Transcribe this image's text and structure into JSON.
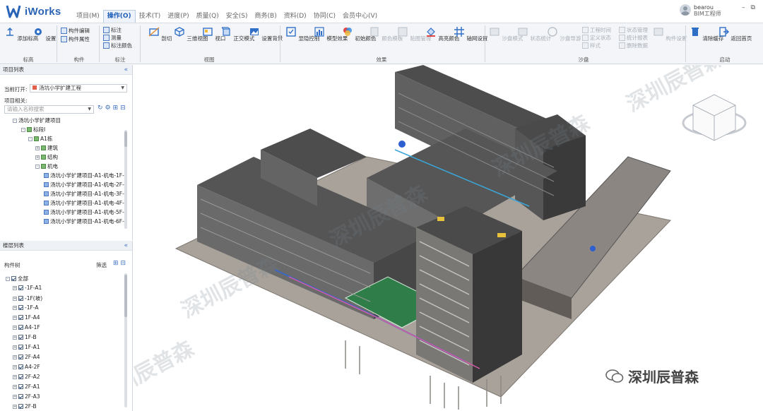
{
  "app": {
    "name": "iWorks"
  },
  "menu": [
    "项目(M)",
    "操作(O)",
    "技术(T)",
    "进度(P)",
    "质量(Q)",
    "安全(S)",
    "商务(B)",
    "资料(D)",
    "协同(C)",
    "会员中心(V)"
  ],
  "user": {
    "name": "bearou",
    "role": "BIM工程师"
  },
  "window_controls": {
    "minimize": "–",
    "restore": "⧉"
  },
  "ribbon": {
    "tools": {
      "add_mark": "添加标高",
      "settings": "设置",
      "comp_edit": "构件编辑",
      "comp_prop": "构件属性",
      "annotate": "标注",
      "measure": "测量",
      "mark_color": "标注颜色",
      "section": "剖切",
      "view3d": "三维视图",
      "viewport": "视口",
      "ortho": "正交模式",
      "bg": "设置背景",
      "visibility": "显隐控制",
      "model_effect": "模型效果",
      "init_color": "初始颜色",
      "color_tpl": "颜色模板",
      "tex_mgr": "贴图管理",
      "hl_color": "高亮颜色",
      "axis_set": "轴网设置",
      "sand_mode": "沙盘模式",
      "state_stat": "状态统计",
      "sand_roam": "沙盘导游",
      "eng_time": "工程时间",
      "def_state": "定义状态",
      "style": "样式",
      "state_mgr": "状态管理",
      "stat_report": "统计报表",
      "del_data": "删除数据",
      "comp_set": "构件设置",
      "clear_cache": "清除缓存",
      "return_home": "返回首页"
    },
    "groups": {
      "mark": "标高",
      "comp": "构件",
      "annotate": "标注",
      "view": "视图",
      "effect": "效果",
      "sand": "沙盘",
      "start": "启动"
    }
  },
  "project_panel": {
    "title": "项目列表",
    "current_label": "当前打开:",
    "current_value": "汤坑小学扩建工程",
    "related_label": "项目相关:",
    "search_placeholder": "请输入名称搜索",
    "tree": [
      "汤坑小学扩建项目",
      "标段I",
      "A1栋",
      "建筑",
      "结构",
      "机电",
      "汤坑小学扩建项目-A1-机电-1F-2",
      "汤坑小学扩建项目-A1-机电-2F-2",
      "汤坑小学扩建项目-A1-机电-3F-2",
      "汤坑小学扩建项目-A1-机电-4F-2",
      "汤坑小学扩建项目-A1-机电-5F-2",
      "汤坑小学扩建项目-A1-机电-6F-2"
    ]
  },
  "layer_panel": {
    "title": "楼层列表",
    "tree_label": "构件树",
    "filter": "筛选",
    "items": [
      "全部",
      "-1F-A1",
      "-1F(坡)",
      "-1F-A",
      "1F-A4",
      "A4-1F",
      "1F-B",
      "1F-A1",
      "2F-A4",
      "A4-2F",
      "2F-A2",
      "2F-A1",
      "2F-A3",
      "2F-B"
    ]
  },
  "watermark": {
    "text": "深圳辰普森"
  },
  "colors": {
    "accent": "#1f5fb8",
    "panel_header": "#eef1f5",
    "ribbon": "#f3f5f8"
  }
}
